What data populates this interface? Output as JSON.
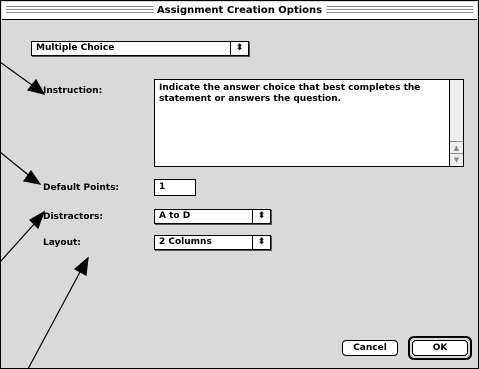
{
  "window": {
    "title": "Assignment Creation Options"
  },
  "assignment_type": {
    "selected": "Multiple Choice",
    "arrow_glyph": "⬍"
  },
  "instruction": {
    "label": "Instruction:",
    "value": "Indicate the answer choice that best completes the statement or answers the question.",
    "scroll_up_glyph": "▲",
    "scroll_down_glyph": "▼"
  },
  "default_points": {
    "label": "Default Points:",
    "value": "1"
  },
  "distractors": {
    "label": "Distractors:",
    "selected": "A to D",
    "arrow_glyph": "⬍"
  },
  "layout": {
    "label": "Layout:",
    "selected": "2 Columns",
    "arrow_glyph": "⬍"
  },
  "buttons": {
    "cancel": "Cancel",
    "ok": "OK"
  }
}
